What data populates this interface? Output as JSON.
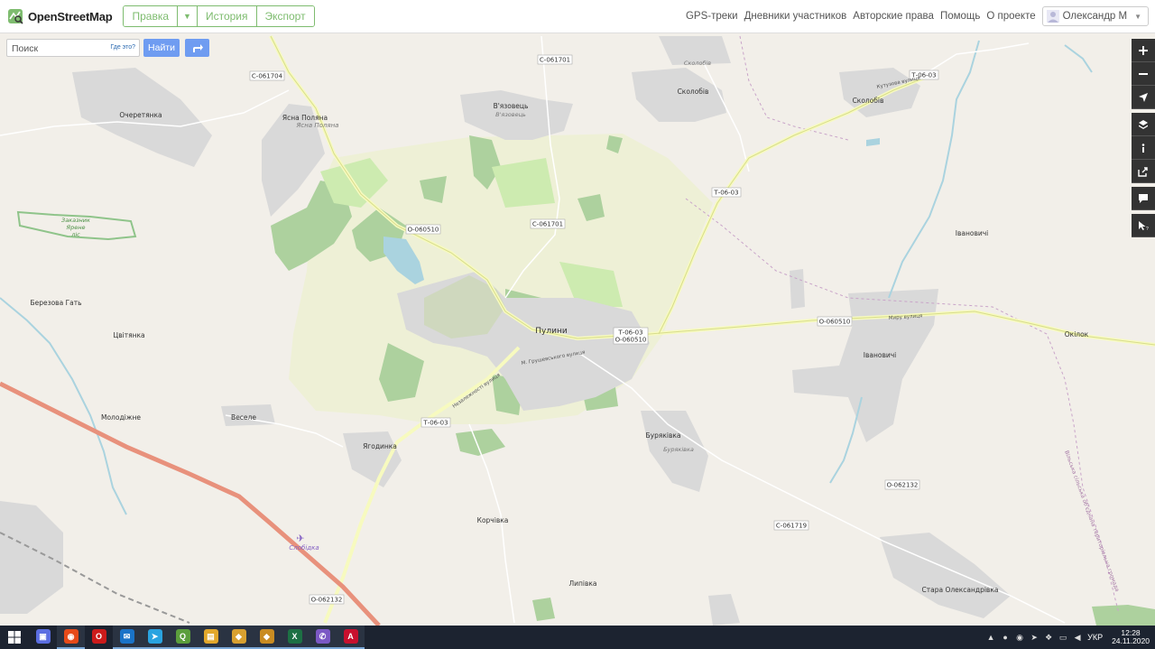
{
  "header": {
    "logo_text": "OpenStreetMap",
    "tabs": {
      "edit": "Правка",
      "history": "История",
      "export": "Экспорт"
    },
    "nav": [
      "GPS-треки",
      "Дневники участников",
      "Авторские права",
      "Помощь",
      "О проекте"
    ],
    "user_name": "Олександр М"
  },
  "search": {
    "placeholder": "Поиск",
    "where_link": "Где это?",
    "find_label": "Найти"
  },
  "map": {
    "accent_green": "#7ebc6f",
    "button_blue": "#6f9cf1",
    "place_labels": {
      "ocheretyanka": "Очеретянка",
      "yasna_polyana": "Ясна Поляна",
      "yasna_polyana_ua": "Ясна Поляна",
      "vyazovets": "В'язовець",
      "vyazovets_small": "В'язовець",
      "skolobiv_top": "Сколобів",
      "skolobiv_mid": "Сколобів",
      "skolobiv_right": "Сколобів",
      "ivanovychi_top": "Івановичі",
      "ivanovychi": "Івановичі",
      "okilok": "Окілок",
      "berezova_gat": "Березова Гать",
      "tsvityanka": "Цвітянка",
      "pulyny": "Пулини",
      "molodizhne": "Молодіжне",
      "vesele": "Веселе",
      "yagodynka": "Ягодинка",
      "buryakivka": "Буряківка",
      "buryakivka_small": "Буряківка",
      "korchivka": "Корчівка",
      "lypivka": "Липівка",
      "stara_oleksandrivka": "Стара Олександрівка",
      "slobidka": "Слобідка",
      "zakaznyk": "Заказник",
      "yarene": "Ярене",
      "lis": "ліс"
    },
    "street_labels": {
      "kutuzova": "Кутузова вулиця",
      "myru": "Миру вулиця",
      "hrushevskoho": "М. Грушевського вулиця",
      "nezalezhnosti": "Незалежності вулиця",
      "border": "Вільська сільська об'єднана територіальна громада"
    },
    "road_shields": {
      "c061704": "С-061704",
      "c061701_top": "С-061701",
      "c061701_mid": "С-061701",
      "t0603_top": "Т-06-03",
      "t0603_mid": "Т-06-03",
      "t0603_bottom": "Т-06-03",
      "o060510_left": "О-060510",
      "o060510_right": "О-060510",
      "t0603_o060510_a": "Т-06-03",
      "t0603_o060510_b": "О-060510",
      "o062132_right": "О-062132",
      "o062132_bottom": "О-062132",
      "c061719": "С-061719"
    }
  },
  "controls": {
    "icons": [
      "zoom-in-icon",
      "zoom-out-icon",
      "locate-icon",
      "layers-icon",
      "info-icon",
      "share-icon",
      "note-icon",
      "query-icon"
    ]
  },
  "taskbar": {
    "apps": [
      {
        "name": "Файл",
        "color": "#5b6ee1"
      },
      {
        "name": "Chrome",
        "color": "#e64a19"
      },
      {
        "name": "Opera",
        "color": "#cc1b1b"
      },
      {
        "name": "Outlook",
        "color": "#1a73c8"
      },
      {
        "name": "Telegram",
        "color": "#2aa3e0"
      },
      {
        "name": "QGIS",
        "color": "#5b9e3c"
      },
      {
        "name": "Explorer",
        "color": "#e2a72b"
      },
      {
        "name": "GIS1",
        "color": "#d8a030"
      },
      {
        "name": "GIS2",
        "color": "#c98c22"
      },
      {
        "name": "Excel",
        "color": "#1d7044"
      },
      {
        "name": "Viber",
        "color": "#7b58c4"
      },
      {
        "name": "Acrobat",
        "color": "#c8102e"
      }
    ],
    "lang": "УКР",
    "time": "12:28",
    "date": "24.11.2020"
  }
}
